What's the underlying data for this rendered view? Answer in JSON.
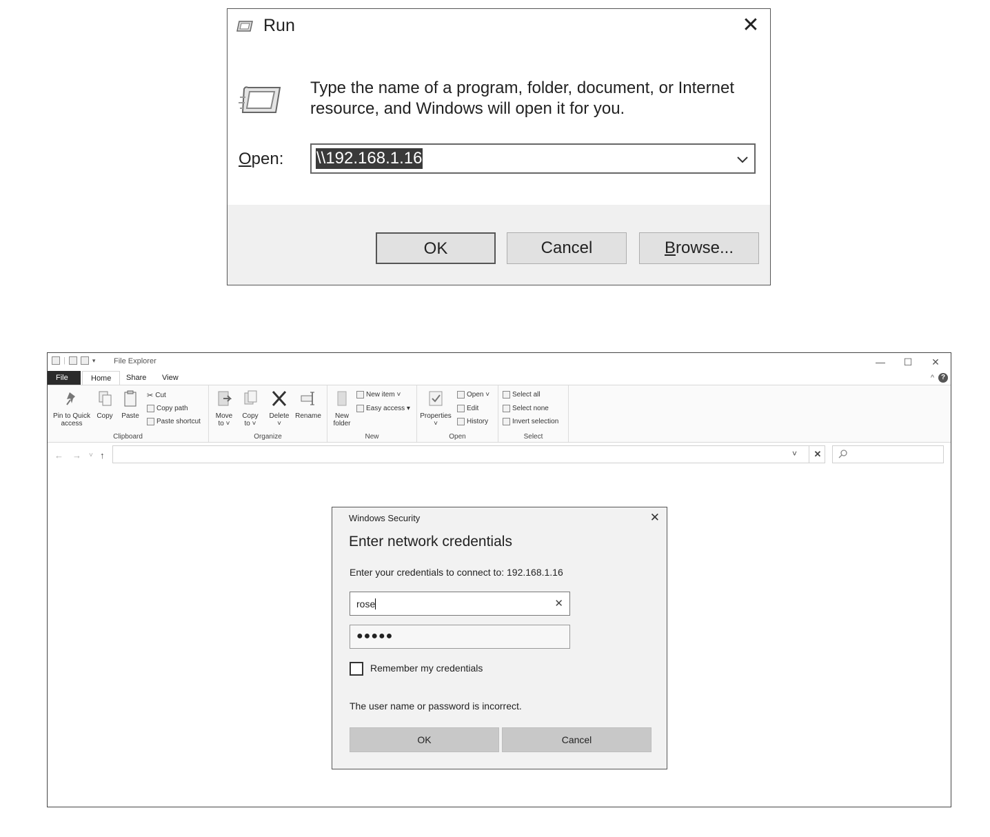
{
  "run_dialog": {
    "title": "Run",
    "close_glyph": "✕",
    "description": "Type the name of a program, folder, document, or Internet resource, and Windows will open it for you.",
    "open_label_accel": "O",
    "open_label_rest": "pen:",
    "open_value": "\\\\192.168.1.16",
    "buttons": {
      "ok": "OK",
      "cancel": "Cancel",
      "browse_accel": "B",
      "browse_rest": "rowse..."
    }
  },
  "file_explorer": {
    "title": "File Explorer",
    "window_controls": {
      "minimize": "—",
      "maximize": "☐",
      "close": "✕"
    },
    "tabs": [
      "File",
      "Home",
      "Share",
      "View"
    ],
    "active_tab": "Home",
    "help_chevron": "^",
    "help_glyph": "?",
    "ribbon": {
      "clipboard": {
        "label": "Clipboard",
        "pin": "Pin to Quick",
        "pin2": "access",
        "copy": "Copy",
        "paste": "Paste",
        "cut": "Cut",
        "copy_path": "Copy path",
        "paste_shortcut": "Paste shortcut"
      },
      "organize": {
        "label": "Organize",
        "move_to": "Move",
        "move_to2": "to ˅",
        "copy_to": "Copy",
        "copy_to2": "to ˅",
        "delete": "Delete",
        "delete2": "˅",
        "rename": "Rename"
      },
      "new": {
        "label": "New",
        "new_folder": "New",
        "new_folder2": "folder",
        "new_item": "New item ˅",
        "easy_access": "Easy access ▾"
      },
      "open": {
        "label": "Open",
        "properties": "Properties",
        "properties2": "˅",
        "open": "Open ˅",
        "edit": "Edit",
        "history": "History"
      },
      "select": {
        "label": "Select",
        "select_all": "Select all",
        "select_none": "Select none",
        "invert": "Invert selection"
      }
    },
    "nav": {
      "back": "←",
      "forward": "→",
      "recent": "˅",
      "up": "↑"
    },
    "address_dropdown": "˅",
    "address_clear": "✕"
  },
  "credentials_dialog": {
    "window_title": "Windows Security",
    "close_glyph": "✕",
    "heading": "Enter network credentials",
    "message": "Enter your credentials to connect to: 192.168.1.16",
    "username": "rose",
    "clear_glyph": "✕",
    "password_mask": "●●●●●",
    "remember_label": "Remember my credentials",
    "remember_checked": false,
    "error": "The user name or password is incorrect.",
    "ok": "OK",
    "cancel": "Cancel"
  }
}
